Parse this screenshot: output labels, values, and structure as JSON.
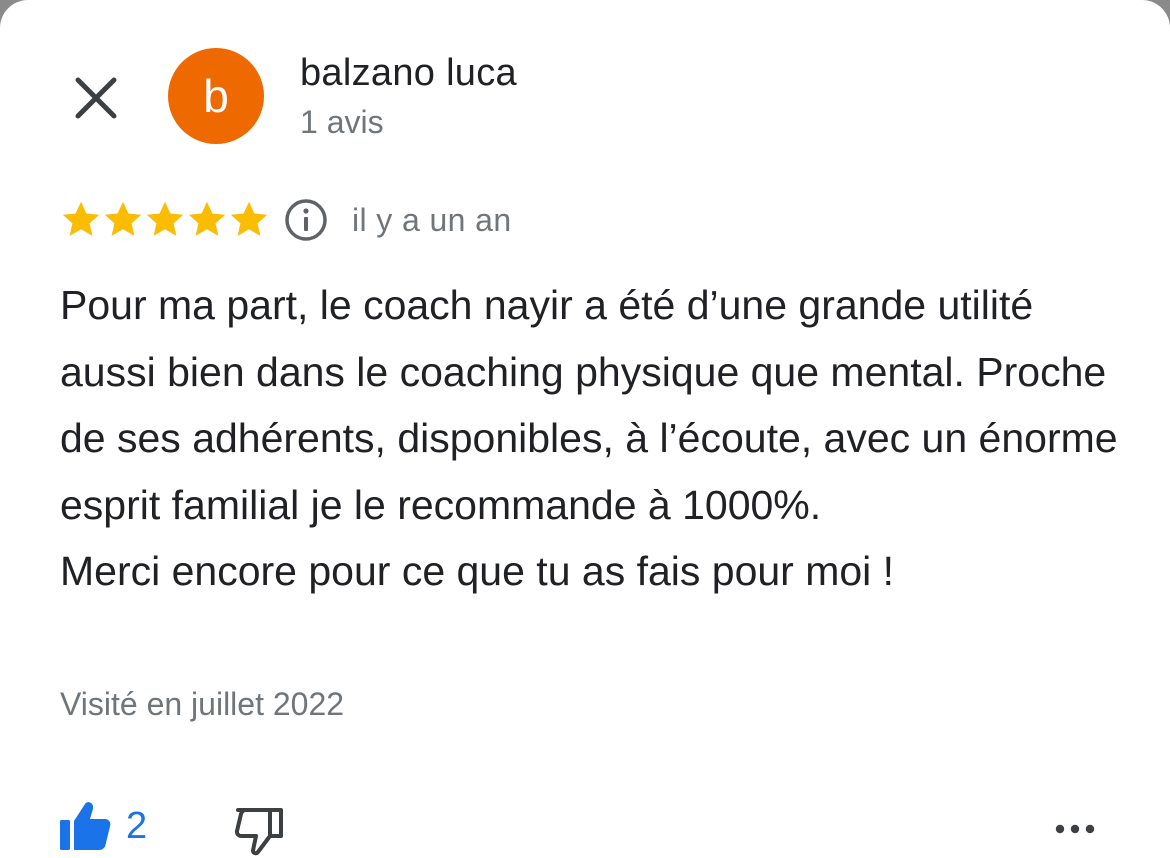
{
  "header": {
    "close_icon": "close-icon",
    "avatar_letter": "b",
    "avatar_color": "#ee6a00",
    "author_name": "balzano luca",
    "author_meta": "1 avis"
  },
  "review": {
    "rating": 5,
    "rating_max": 5,
    "star_color": "#fbbc04",
    "info_icon": "info-icon",
    "date": "il y a un an",
    "text_paragraphs": [
      "Pour ma part, le coach nayir a été d’une grande utilité aussi bien dans le coaching physique que mental. Proche de ses adhérents, disponibles, à l’écoute, avec un énorme esprit familial je le recommande à 1000%.",
      "Merci encore pour ce que tu as fais pour moi !"
    ],
    "visited": "Visité en juillet 2022"
  },
  "actions": {
    "like_icon": "thumbs-up-icon",
    "like_count": "2",
    "like_color": "#1a73e8",
    "dislike_icon": "thumbs-down-icon",
    "more_icon": "more-horizontal-icon"
  }
}
